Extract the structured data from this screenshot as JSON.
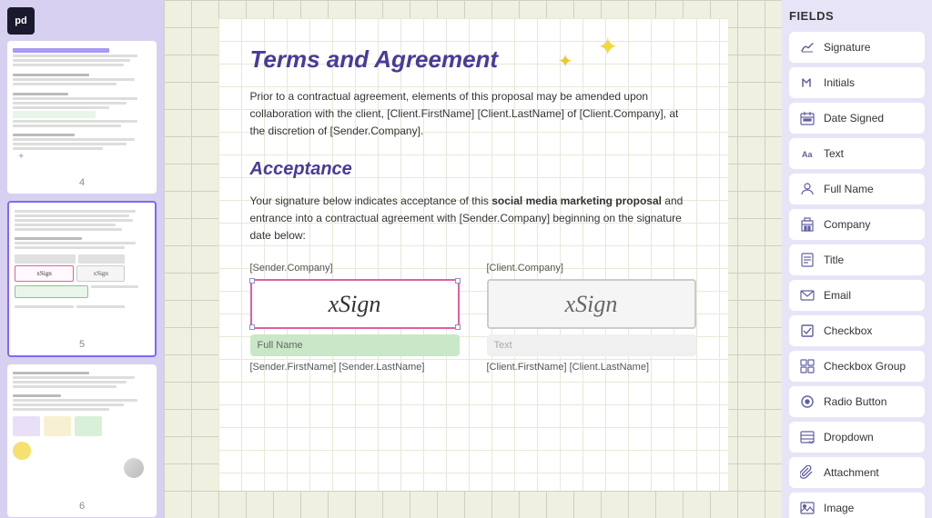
{
  "app": {
    "logo": "pd"
  },
  "left_sidebar": {
    "pages": [
      {
        "number": "4",
        "active": false
      },
      {
        "number": "5",
        "active": true
      },
      {
        "number": "6",
        "active": false
      }
    ]
  },
  "document": {
    "sparkle_char": "✦",
    "sparkle2_char": "✦",
    "section1": {
      "title": "Terms and Agreement",
      "body": "Prior to a contractual agreement, elements of this proposal may be amended upon collaboration with the client, [Client.FirstName] [Client.LastName] of [Client.Company], at the discretion of [Sender.Company]."
    },
    "section2": {
      "title": "Acceptance",
      "body_prefix": "Your signature below indicates acceptance of this ",
      "body_bold": "social media marketing proposal",
      "body_suffix": " and entrance into a contractual agreement with [Sender.Company] beginning on the signature date below:"
    },
    "sig_left": {
      "label": "[Sender.Company]",
      "sign_text": "xSign",
      "name_placeholder": "Full Name",
      "name_below": "[Sender.FirstName] [Sender.LastName]"
    },
    "sig_right": {
      "label": "[Client.Company]",
      "sign_text": "xSign",
      "text_placeholder": "Text",
      "name_below": "[Client.FirstName] [Client.LastName]"
    }
  },
  "fields_panel": {
    "title": "FIELDS",
    "items": [
      {
        "id": "signature",
        "label": "Signature",
        "icon": "✍"
      },
      {
        "id": "initials",
        "label": "Initials",
        "icon": "∫"
      },
      {
        "id": "date-signed",
        "label": "Date Signed",
        "icon": "📅"
      },
      {
        "id": "text",
        "label": "Text",
        "icon": "Aa"
      },
      {
        "id": "full-name",
        "label": "Full Name",
        "icon": "👤"
      },
      {
        "id": "company",
        "label": "Company",
        "icon": "🏢"
      },
      {
        "id": "title",
        "label": "Title",
        "icon": "📄"
      },
      {
        "id": "email",
        "label": "Email",
        "icon": "✉"
      },
      {
        "id": "checkbox",
        "label": "Checkbox",
        "icon": "☑"
      },
      {
        "id": "checkbox-group",
        "label": "Checkbox Group",
        "icon": "⊞"
      },
      {
        "id": "radio-button",
        "label": "Radio Button",
        "icon": "◎"
      },
      {
        "id": "dropdown",
        "label": "Dropdown",
        "icon": "▤"
      },
      {
        "id": "attachment",
        "label": "Attachment",
        "icon": "📎"
      },
      {
        "id": "image",
        "label": "Image",
        "icon": "🖼"
      }
    ]
  }
}
